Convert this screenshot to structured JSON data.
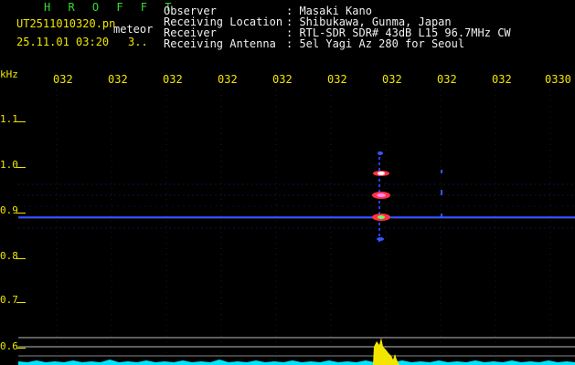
{
  "header": {
    "logo": "H R O F F T",
    "filename": "UT2511010320.pn",
    "type": "meteor",
    "datetime": "25.11.01 03:20",
    "count": "3..",
    "fields": [
      {
        "label": "Observer",
        "value": ": Masaki Kano"
      },
      {
        "label": "Receiving Location",
        "value": ": Shibukawa, Gunma, Japan"
      },
      {
        "label": "Receiver",
        "value": ": RTL-SDR SDR# 43dB L15 96.7MHz CW"
      },
      {
        "label": "Receiving Antenna",
        "value": ": 5el Yagi Az 280 for Seoul"
      }
    ]
  },
  "axis": {
    "unit": "kHz",
    "x_ticks": [
      "032",
      "032",
      "032",
      "032",
      "032",
      "032",
      "032",
      "032",
      "032",
      "0330"
    ],
    "y_ticks": [
      "1.1",
      "1.0",
      "0.9",
      "0.8",
      "0.7",
      "0.6"
    ]
  },
  "colors": {
    "background": "#000000",
    "axis_text": "#f2e600",
    "header_text": "#f0f0f0",
    "logo": "#33dd33",
    "signal_line": "#2a3cff",
    "noise_bottom": "#00e5ff",
    "burst": "#f2e600"
  }
}
